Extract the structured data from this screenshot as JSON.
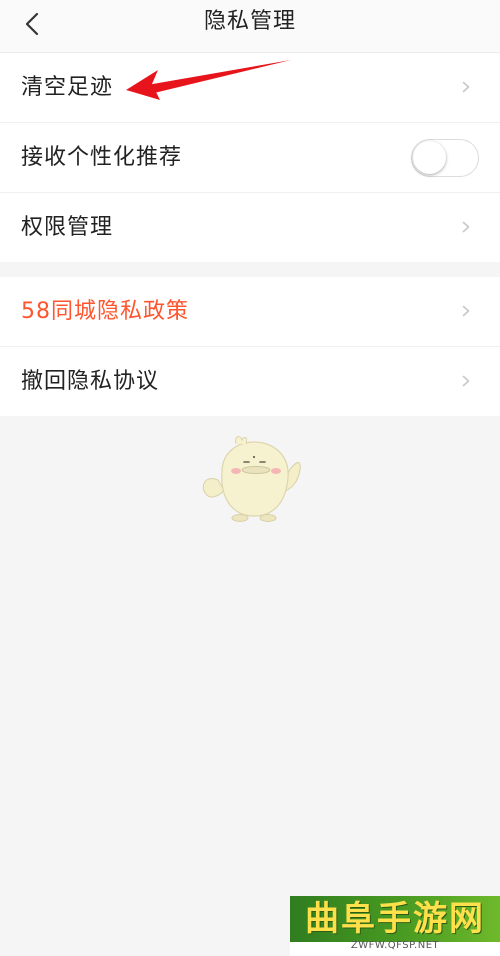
{
  "header": {
    "title": "隐私管理",
    "back_icon": "chevron-left-icon"
  },
  "group1": {
    "items": [
      {
        "label": "清空足迹",
        "control": "chevron"
      },
      {
        "label": "接收个性化推荐",
        "control": "toggle",
        "toggle_on": false
      },
      {
        "label": "权限管理",
        "control": "chevron"
      }
    ]
  },
  "group2": {
    "items": [
      {
        "label": "58同城隐私政策",
        "control": "chevron",
        "color": "#ff552e"
      },
      {
        "label": "撤回隐私协议",
        "control": "chevron"
      }
    ]
  },
  "watermark": {
    "title": "曲阜手游网",
    "url": "ZWFW.QFSP.NET"
  },
  "colors": {
    "accent": "#ff552e",
    "annotation_arrow": "#e8141b",
    "background": "#f5f5f5"
  }
}
